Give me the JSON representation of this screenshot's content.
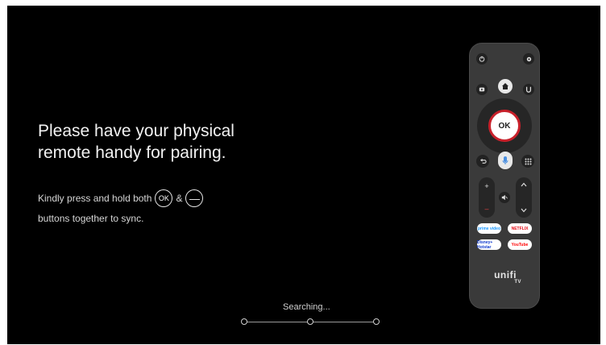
{
  "screen": {
    "title_line1": "Please have your physical",
    "title_line2": "remote handy for pairing.",
    "instruction_prefix": "Kindly press and hold both",
    "instruction_ok": "OK",
    "instruction_and": "&",
    "instruction_minus": "—",
    "instruction_suffix": "buttons together to sync.",
    "status": "Searching..."
  },
  "remote": {
    "ok_label": "OK",
    "vol_plus": "+",
    "vol_minus": "–",
    "apps": [
      "prime video",
      "NETFLIX",
      "Disney+ Hotstar",
      "YouTube"
    ],
    "brand": "unifi",
    "brand_sub": "TV"
  },
  "colors": {
    "background": "#000000",
    "remote_body": "#3a3a3a",
    "ok_ring": "#c8202a",
    "mic_accent": "#4a8fe0",
    "netflix": "#e50914",
    "youtube": "#ff0000"
  }
}
